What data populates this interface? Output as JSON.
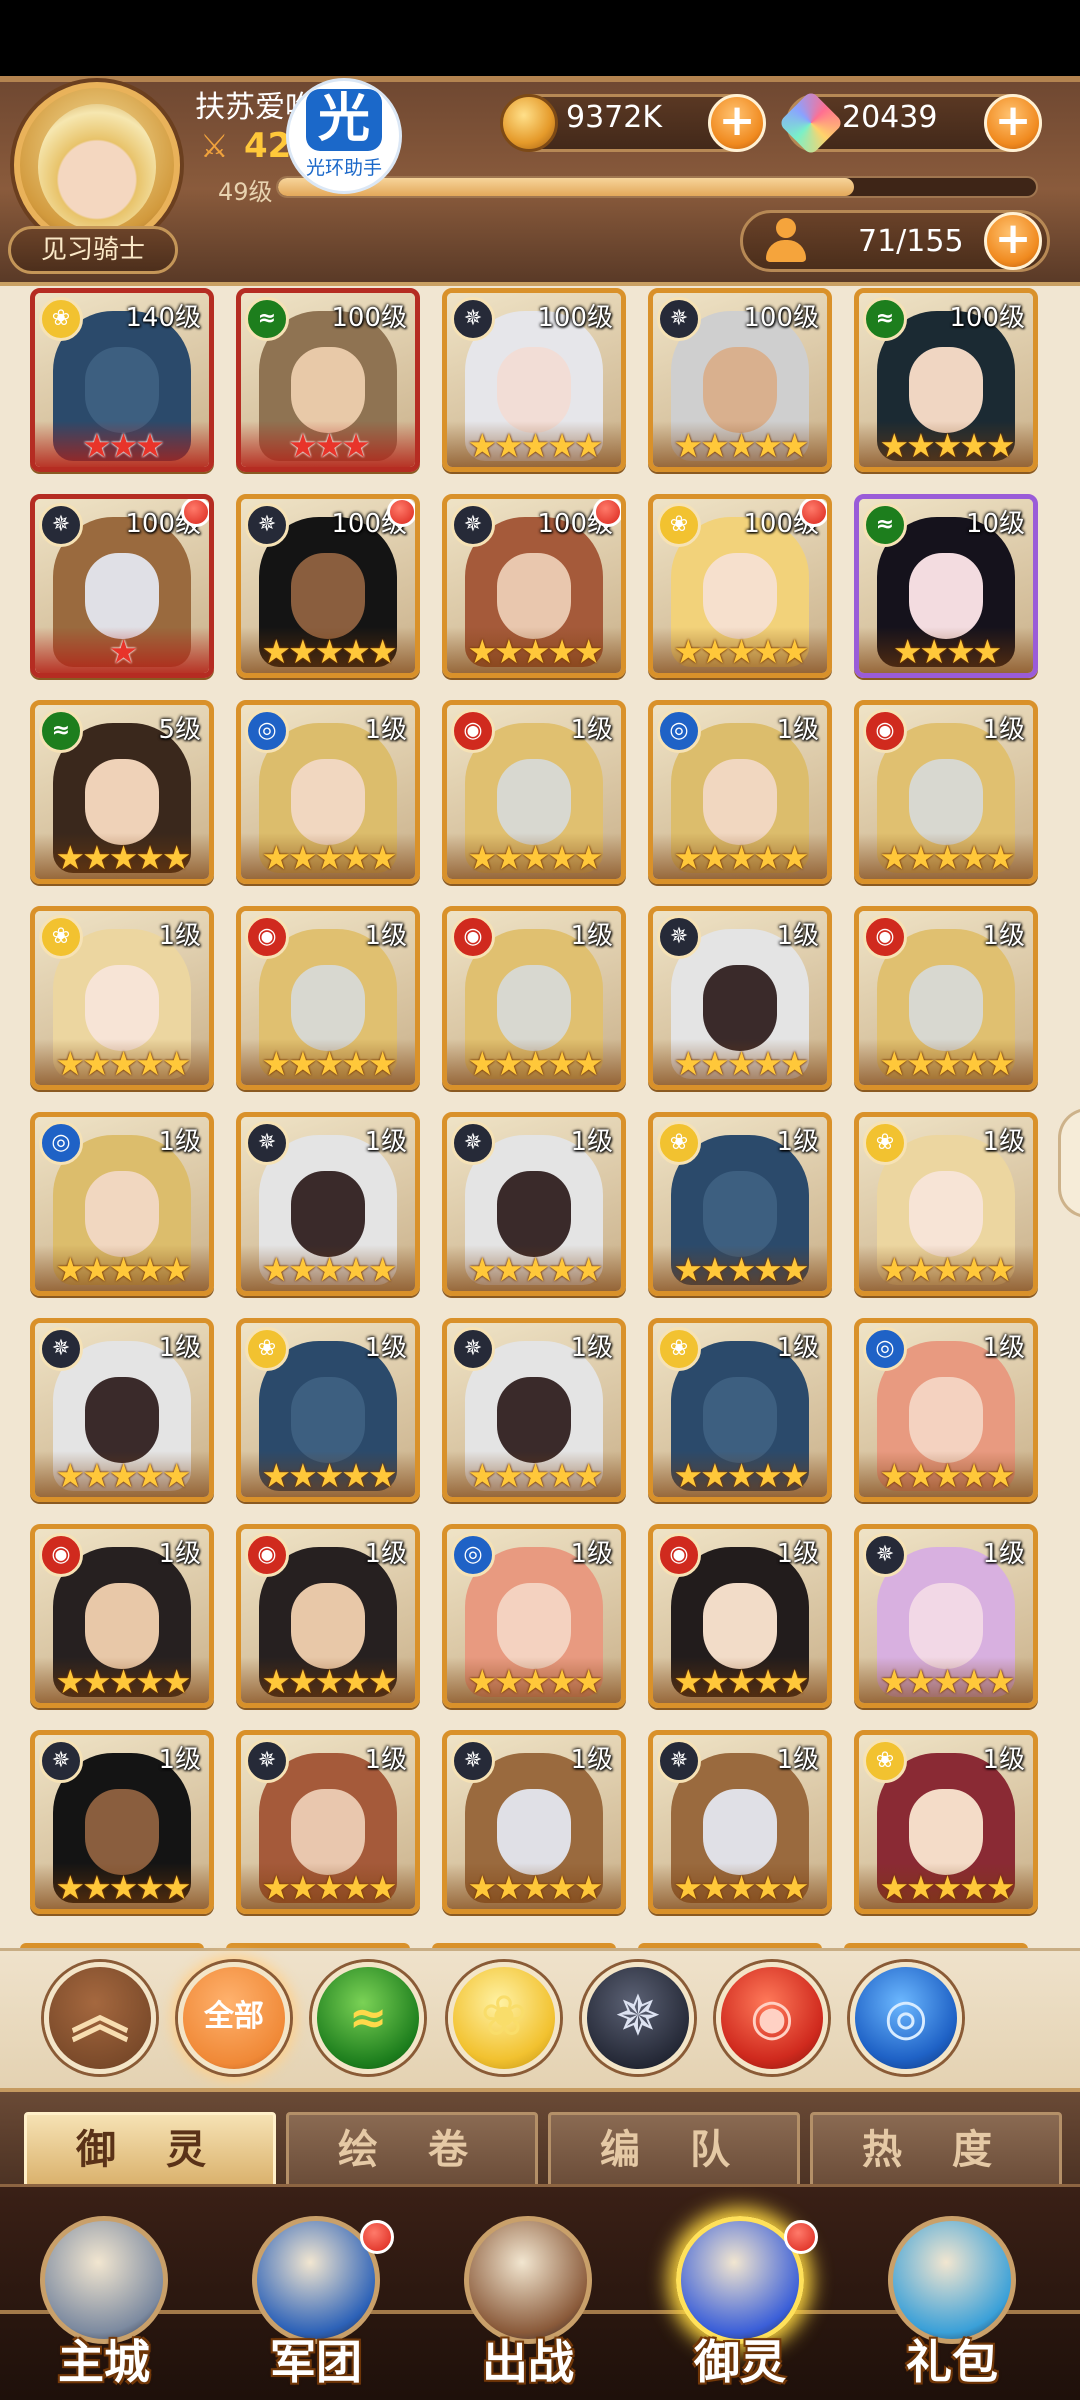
{
  "player": {
    "name": "扶苏爱吃",
    "power": "42",
    "level": "49级",
    "exp_fraction": 0.76,
    "rank": "见习骑士"
  },
  "watermark": {
    "glyph": "光",
    "text": "光环助手"
  },
  "resources": {
    "gold": "9372K",
    "gems": "20439",
    "roster": "71/155",
    "plus": "+"
  },
  "colors": {
    "light": "#f2c230",
    "wind": "#1d7e1d",
    "dark": "#262a38",
    "fire": "#d02a1e",
    "water": "#1f62c6",
    "card_gold_border": "#d9912a",
    "card_red_border": "#b52c22",
    "card_purple_border": "#9a5cd8"
  },
  "heroes": [
    {
      "elem": "light",
      "level": "140级",
      "stars": 3,
      "star_color": "red",
      "frame": "red",
      "hair": "#2b4a6b",
      "skin": "#3d5f80",
      "dot": false
    },
    {
      "elem": "wind",
      "level": "100级",
      "stars": 3,
      "star_color": "red",
      "frame": "red",
      "hair": "#8f7352",
      "skin": "#e8c9a8",
      "dot": false
    },
    {
      "elem": "dark",
      "level": "100级",
      "stars": 5,
      "star_color": "gold",
      "frame": "gold",
      "hair": "#e6e6ea",
      "skin": "#f2ddd6",
      "dot": false
    },
    {
      "elem": "dark",
      "level": "100级",
      "stars": 5,
      "star_color": "gold",
      "frame": "gold",
      "hair": "#cfcfcf",
      "skin": "#d9b08e",
      "dot": false
    },
    {
      "elem": "wind",
      "level": "100级",
      "stars": 5,
      "star_color": "gold",
      "frame": "gold",
      "hair": "#1b2a33",
      "skin": "#f0d6c2",
      "dot": false
    },
    {
      "elem": "dark",
      "level": "100级",
      "stars": 1,
      "star_color": "red",
      "frame": "red",
      "hair": "#9a6a3e",
      "skin": "#e0e0e6",
      "dot": true
    },
    {
      "elem": "dark",
      "level": "100级",
      "stars": 5,
      "star_color": "gold",
      "frame": "gold",
      "hair": "#141414",
      "skin": "#8a5e3e",
      "dot": true
    },
    {
      "elem": "dark",
      "level": "100级",
      "stars": 5,
      "star_color": "gold",
      "frame": "gold",
      "hair": "#a55a3a",
      "skin": "#e9c7ae",
      "dot": true
    },
    {
      "elem": "light",
      "level": "100级",
      "stars": 5,
      "star_color": "gold",
      "frame": "gold",
      "hair": "#f2d27a",
      "skin": "#f6e0cd",
      "dot": true
    },
    {
      "elem": "wind",
      "level": "10级",
      "stars": 4,
      "star_color": "gold",
      "frame": "purple",
      "hair": "#15121c",
      "skin": "#f3dce0",
      "dot": false
    },
    {
      "elem": "wind",
      "level": "5级",
      "stars": 5,
      "star_color": "gold",
      "frame": "gold",
      "hair": "#3a281c",
      "skin": "#efd2b8",
      "dot": false
    },
    {
      "elem": "water",
      "level": "1级",
      "stars": 5,
      "star_color": "gold",
      "frame": "gold",
      "hair": "#dcbd6c",
      "skin": "#f1d7c0",
      "dot": false
    },
    {
      "elem": "fire",
      "level": "1级",
      "stars": 5,
      "star_color": "gold",
      "frame": "gold",
      "hair": "#e0c070",
      "skin": "#d8d8d0",
      "dot": false
    },
    {
      "elem": "water",
      "level": "1级",
      "stars": 5,
      "star_color": "gold",
      "frame": "gold",
      "hair": "#dcbd6c",
      "skin": "#f1d7c0",
      "dot": false
    },
    {
      "elem": "fire",
      "level": "1级",
      "stars": 5,
      "star_color": "gold",
      "frame": "gold",
      "hair": "#e0c070",
      "skin": "#d8d8d0",
      "dot": false
    },
    {
      "elem": "light",
      "level": "1级",
      "stars": 5,
      "star_color": "gold",
      "frame": "gold",
      "hair": "#ecd6a0",
      "skin": "#f7e4d6",
      "dot": false
    },
    {
      "elem": "fire",
      "level": "1级",
      "stars": 5,
      "star_color": "gold",
      "frame": "gold",
      "hair": "#e0c070",
      "skin": "#d8d8d0",
      "dot": false
    },
    {
      "elem": "fire",
      "level": "1级",
      "stars": 5,
      "star_color": "gold",
      "frame": "gold",
      "hair": "#e0c070",
      "skin": "#d8d8d0",
      "dot": false
    },
    {
      "elem": "dark",
      "level": "1级",
      "stars": 5,
      "star_color": "gold",
      "frame": "gold",
      "hair": "#e4e4e4",
      "skin": "#3a2a2a",
      "dot": false
    },
    {
      "elem": "fire",
      "level": "1级",
      "stars": 5,
      "star_color": "gold",
      "frame": "gold",
      "hair": "#e0c070",
      "skin": "#d8d8d0",
      "dot": false
    },
    {
      "elem": "water",
      "level": "1级",
      "stars": 5,
      "star_color": "gold",
      "frame": "gold",
      "hair": "#dcbd6c",
      "skin": "#f1d7c0",
      "dot": false
    },
    {
      "elem": "dark",
      "level": "1级",
      "stars": 5,
      "star_color": "gold",
      "frame": "gold",
      "hair": "#e4e4e4",
      "skin": "#3a2a2a",
      "dot": false
    },
    {
      "elem": "dark",
      "level": "1级",
      "stars": 5,
      "star_color": "gold",
      "frame": "gold",
      "hair": "#e4e4e4",
      "skin": "#3a2a2a",
      "dot": false
    },
    {
      "elem": "light",
      "level": "1级",
      "stars": 5,
      "star_color": "gold",
      "frame": "gold",
      "hair": "#2b4a6b",
      "skin": "#3d5f80",
      "dot": false
    },
    {
      "elem": "light",
      "level": "1级",
      "stars": 5,
      "star_color": "gold",
      "frame": "gold",
      "hair": "#ecd6a0",
      "skin": "#f7e4d6",
      "dot": false
    },
    {
      "elem": "dark",
      "level": "1级",
      "stars": 5,
      "star_color": "gold",
      "frame": "gold",
      "hair": "#e4e4e4",
      "skin": "#3a2a2a",
      "dot": false
    },
    {
      "elem": "light",
      "level": "1级",
      "stars": 5,
      "star_color": "gold",
      "frame": "gold",
      "hair": "#2b4a6b",
      "skin": "#3d5f80",
      "dot": false
    },
    {
      "elem": "dark",
      "level": "1级",
      "stars": 5,
      "star_color": "gold",
      "frame": "gold",
      "hair": "#e4e4e4",
      "skin": "#3a2a2a",
      "dot": false
    },
    {
      "elem": "light",
      "level": "1级",
      "stars": 5,
      "star_color": "gold",
      "frame": "gold",
      "hair": "#2b4a6b",
      "skin": "#3d5f80",
      "dot": false
    },
    {
      "elem": "water",
      "level": "1级",
      "stars": 5,
      "star_color": "gold",
      "frame": "gold",
      "hair": "#e89a80",
      "skin": "#f4d2c0",
      "dot": false
    },
    {
      "elem": "fire",
      "level": "1级",
      "stars": 5,
      "star_color": "gold",
      "frame": "gold",
      "hair": "#262020",
      "skin": "#e8c8a8",
      "dot": false
    },
    {
      "elem": "fire",
      "level": "1级",
      "stars": 5,
      "star_color": "gold",
      "frame": "gold",
      "hair": "#262020",
      "skin": "#e8c8a8",
      "dot": false
    },
    {
      "elem": "water",
      "level": "1级",
      "stars": 5,
      "star_color": "gold",
      "frame": "gold",
      "hair": "#e89a80",
      "skin": "#f4d2c0",
      "dot": false
    },
    {
      "elem": "fire",
      "level": "1级",
      "stars": 5,
      "star_color": "gold",
      "frame": "gold",
      "hair": "#221c1c",
      "skin": "#f2dcc8",
      "dot": false
    },
    {
      "elem": "dark",
      "level": "1级",
      "stars": 5,
      "star_color": "gold",
      "frame": "gold",
      "hair": "#d8b0e0",
      "skin": "#f2d8e6",
      "dot": false
    },
    {
      "elem": "dark",
      "level": "1级",
      "stars": 5,
      "star_color": "gold",
      "frame": "gold",
      "hair": "#141414",
      "skin": "#8a5e3e",
      "dot": false
    },
    {
      "elem": "dark",
      "level": "1级",
      "stars": 5,
      "star_color": "gold",
      "frame": "gold",
      "hair": "#a55a3a",
      "skin": "#e9c7ae",
      "dot": false
    },
    {
      "elem": "dark",
      "level": "1级",
      "stars": 5,
      "star_color": "gold",
      "frame": "gold",
      "hair": "#9a6a3e",
      "skin": "#e0e0e6",
      "dot": false
    },
    {
      "elem": "dark",
      "level": "1级",
      "stars": 5,
      "star_color": "gold",
      "frame": "gold",
      "hair": "#9a6a3e",
      "skin": "#e0e0e6",
      "dot": false
    },
    {
      "elem": "light",
      "level": "1级",
      "stars": 5,
      "star_color": "gold",
      "frame": "gold",
      "hair": "#8a2a34",
      "skin": "#f4dcc8",
      "dot": false
    }
  ],
  "filters": {
    "collapse": "︽",
    "all": "全部",
    "wind": "≈",
    "light": "❀",
    "dark": "✵",
    "fire": "◉",
    "water": "◎"
  },
  "subtabs": [
    "御 灵",
    "绘 卷",
    "编 队",
    "热 度"
  ],
  "nav": [
    {
      "label": "主城",
      "color": "#7c8aa0",
      "dot": false
    },
    {
      "label": "军团",
      "color": "#2d62b8",
      "dot": true
    },
    {
      "label": "出战",
      "color": "#8a5a3a",
      "dot": false
    },
    {
      "label": "御灵",
      "color": "#3b5fd8",
      "dot": true
    },
    {
      "label": "礼包",
      "color": "#3aa0d8",
      "dot": false
    }
  ]
}
